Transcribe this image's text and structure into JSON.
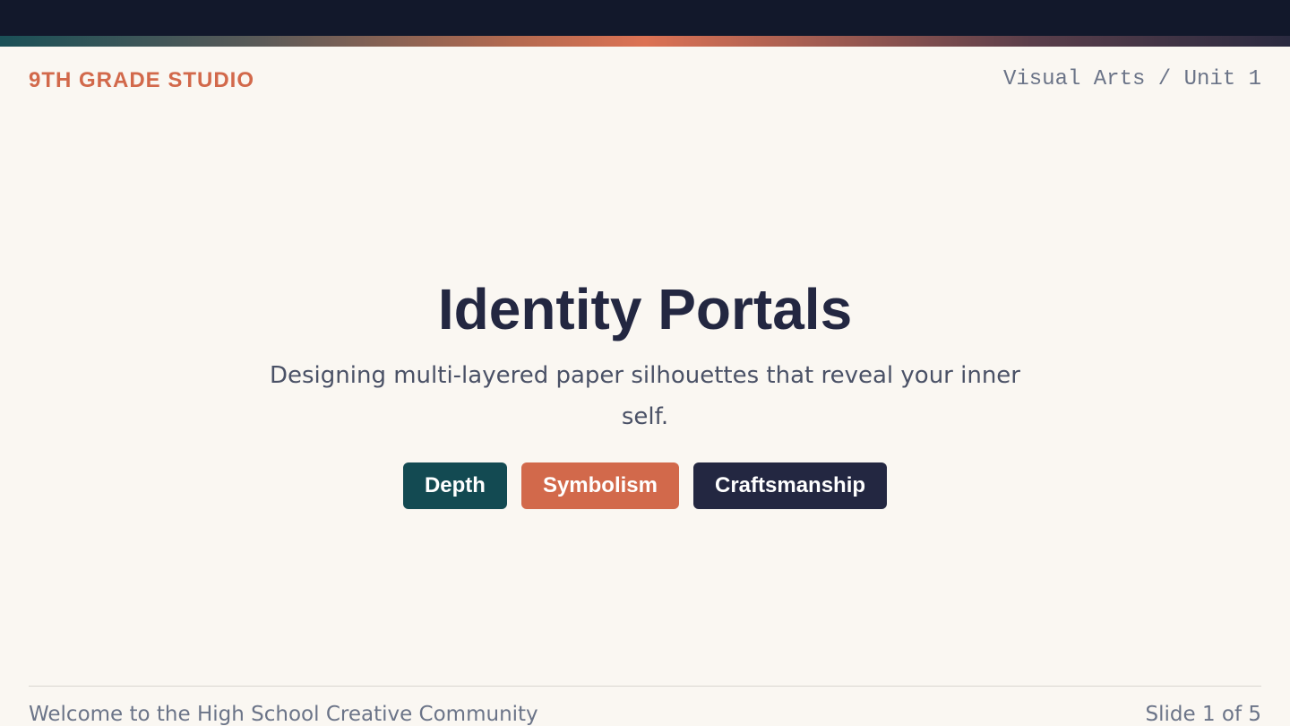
{
  "header": {
    "brand": "9TH GRADE STUDIO",
    "breadcrumb": "Visual Arts / Unit 1"
  },
  "hero": {
    "title": "Identity Portals",
    "subtitle": "Designing multi-layered paper silhouettes that reveal your inner self.",
    "tags": [
      {
        "label": "Depth",
        "color": "#134a52"
      },
      {
        "label": "Symbolism",
        "color": "#d2694b"
      },
      {
        "label": "Craftsmanship",
        "color": "#232741"
      }
    ]
  },
  "footer": {
    "welcome": "Welcome to the High School Creative Community",
    "slide_counter": "Slide 1 of 5"
  },
  "colors": {
    "top_bar": "#12182b",
    "brand_accent": "#d2694b",
    "teal": "#134a52",
    "navy": "#232741",
    "background": "#faf7f2"
  }
}
